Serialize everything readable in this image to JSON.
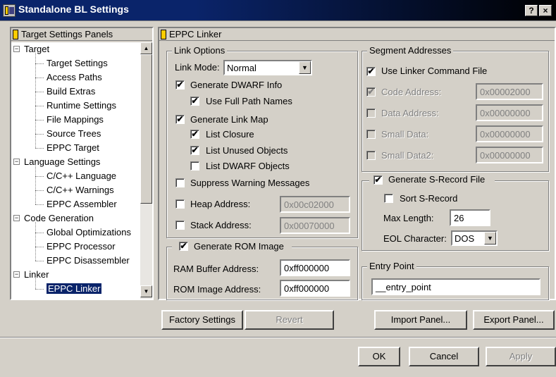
{
  "window": {
    "title": "Standalone BL Settings",
    "help_btn": "?",
    "close_btn": "×"
  },
  "tree": {
    "header": "Target Settings Panels",
    "items": [
      {
        "label": "Target",
        "level": 0,
        "expanded": true
      },
      {
        "label": "Target Settings",
        "level": 1
      },
      {
        "label": "Access Paths",
        "level": 1
      },
      {
        "label": "Build Extras",
        "level": 1
      },
      {
        "label": "Runtime Settings",
        "level": 1
      },
      {
        "label": "File Mappings",
        "level": 1
      },
      {
        "label": "Source Trees",
        "level": 1
      },
      {
        "label": "EPPC Target",
        "level": 1
      },
      {
        "label": "Language Settings",
        "level": 0,
        "expanded": true
      },
      {
        "label": "C/C++ Language",
        "level": 1
      },
      {
        "label": "C/C++ Warnings",
        "level": 1
      },
      {
        "label": "EPPC Assembler",
        "level": 1
      },
      {
        "label": "Code Generation",
        "level": 0,
        "expanded": true
      },
      {
        "label": "Global Optimizations",
        "level": 1
      },
      {
        "label": "EPPC Processor",
        "level": 1
      },
      {
        "label": "EPPC Disassembler",
        "level": 1
      },
      {
        "label": "Linker",
        "level": 0,
        "expanded": true
      },
      {
        "label": "EPPC Linker",
        "level": 1,
        "selected": true
      }
    ]
  },
  "panel": {
    "title": "EPPC Linker"
  },
  "link_options": {
    "label": "Link Options",
    "link_mode_label": "Link Mode:",
    "link_mode_value": "Normal",
    "gen_dwarf": {
      "label": "Generate DWARF Info",
      "checked": true
    },
    "full_path": {
      "label": "Use Full Path Names",
      "checked": true
    },
    "gen_link_map": {
      "label": "Generate Link Map",
      "checked": true
    },
    "list_closure": {
      "label": "List Closure",
      "checked": true
    },
    "list_unused": {
      "label": "List Unused Objects",
      "checked": true
    },
    "list_dwarf": {
      "label": "List DWARF Objects",
      "checked": false
    },
    "suppress": {
      "label": "Suppress Warning Messages",
      "checked": false
    },
    "heap": {
      "label": "Heap Address:",
      "checked": false,
      "value": "0x00c02000"
    },
    "stack": {
      "label": "Stack Address:",
      "checked": false,
      "value": "0x00070000"
    }
  },
  "rom": {
    "label": "Generate ROM Image",
    "checked": true,
    "ram_label": "RAM Buffer Address:",
    "ram_value": "0xff000000",
    "rom_label": "ROM Image Address:",
    "rom_value": "0xff000000"
  },
  "segment": {
    "label": "Segment Addresses",
    "use_cmd": {
      "label": "Use Linker Command File",
      "checked": true
    },
    "code": {
      "label": "Code Address:",
      "checked": true,
      "value": "0x00002000"
    },
    "data": {
      "label": "Data Address:",
      "checked": false,
      "value": "0x00000000"
    },
    "small": {
      "label": "Small Data:",
      "checked": false,
      "value": "0x00000000"
    },
    "small2": {
      "label": "Small Data2:",
      "checked": false,
      "value": "0x00000000"
    }
  },
  "srec": {
    "label": "Generate S-Record File",
    "checked": true,
    "sort": {
      "label": "Sort S-Record",
      "checked": false
    },
    "max_len_label": "Max Length:",
    "max_len_value": "26",
    "eol_label": "EOL Character:",
    "eol_value": "DOS"
  },
  "entry": {
    "label": "Entry Point",
    "value": "__entry_point"
  },
  "buttons": {
    "factory": "Factory Settings",
    "revert": "Revert",
    "import": "Import Panel...",
    "export": "Export Panel...",
    "ok": "OK",
    "cancel": "Cancel",
    "apply": "Apply"
  }
}
